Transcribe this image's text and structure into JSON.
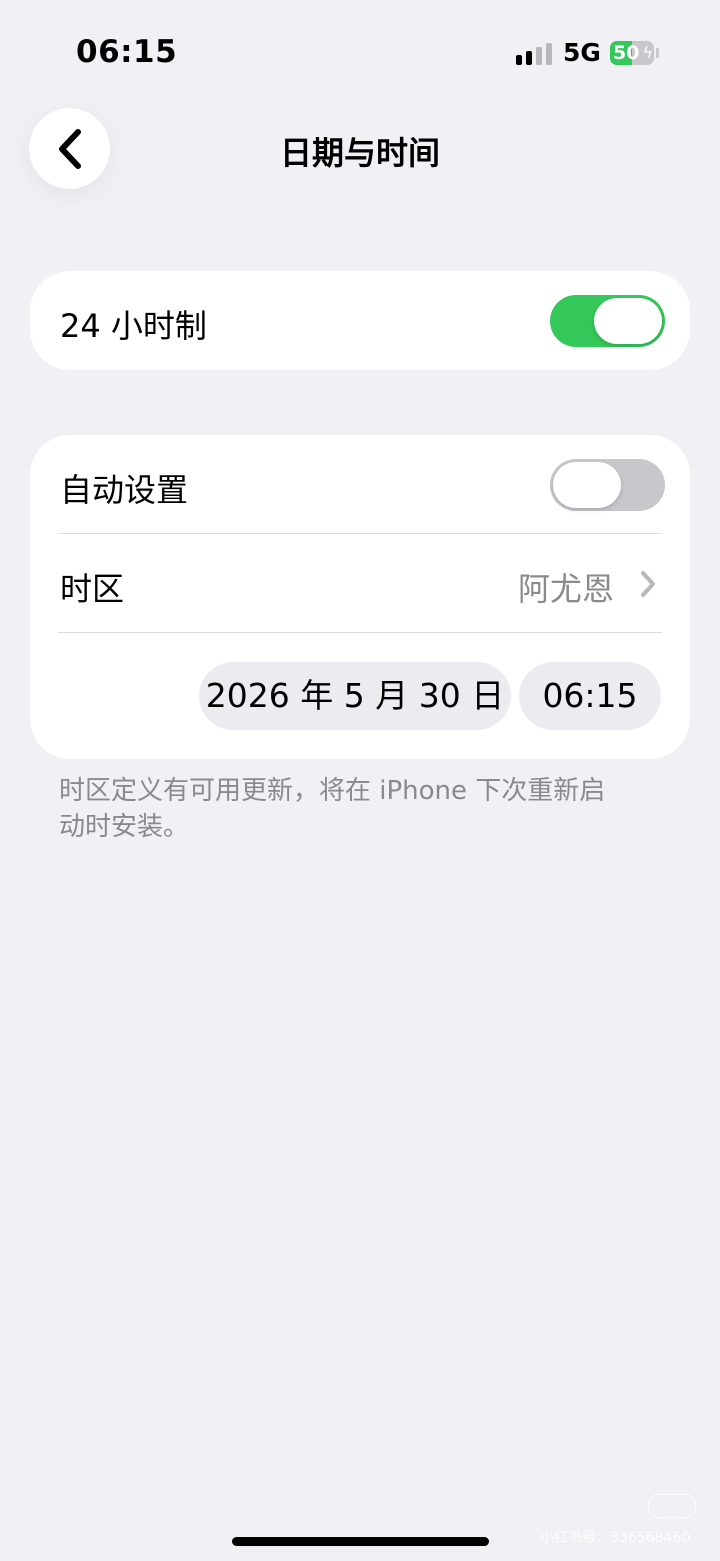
{
  "status_bar": {
    "time": "06:15",
    "network": "5G",
    "battery_level": "50",
    "battery_fraction": 0.5,
    "charging_icon": "bolt-icon"
  },
  "nav": {
    "back_icon": "chevron-left-icon",
    "title": "日期与时间"
  },
  "section_24h": {
    "label": "24 小时制",
    "toggle_on": true
  },
  "section_auto": {
    "auto_label": "自动设置",
    "auto_on": false,
    "timezone_label": "时区",
    "timezone_value": "阿尤恩",
    "date_value": "2026 年 5 月 30 日",
    "time_value": "06:15"
  },
  "footnote": "时区定义有可用更新，将在 iPhone 下次重新启动时安装。",
  "watermark": {
    "logo": "小红书",
    "text": "小红书号：336568460"
  },
  "colors": {
    "background": "#f0f0f5",
    "toggle_on": "#34c759",
    "toggle_off": "#c7c7cc",
    "secondary_text": "#8a8a8e"
  }
}
